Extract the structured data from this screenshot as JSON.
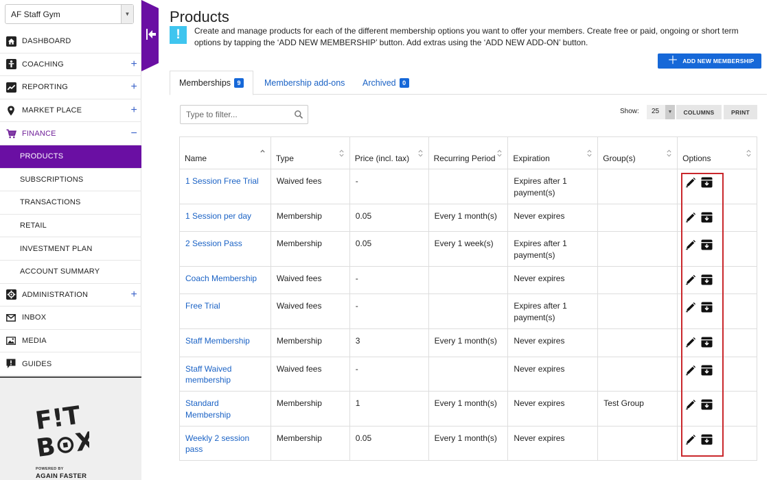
{
  "sidebar": {
    "gym_name": "AF Staff Gym",
    "items": [
      {
        "label": "DASHBOARD",
        "icon": "home-icon"
      },
      {
        "label": "COACHING",
        "icon": "coaching-icon",
        "expand": "+"
      },
      {
        "label": "REPORTING",
        "icon": "chart-icon",
        "expand": "+"
      },
      {
        "label": "MARKET PLACE",
        "icon": "location-pin-icon",
        "expand": "+"
      },
      {
        "label": "FINANCE",
        "icon": "cart-icon",
        "expand": "−"
      },
      {
        "label": "PRODUCTS"
      },
      {
        "label": "SUBSCRIPTIONS"
      },
      {
        "label": "TRANSACTIONS"
      },
      {
        "label": "RETAIL"
      },
      {
        "label": "INVESTMENT PLAN"
      },
      {
        "label": "ACCOUNT SUMMARY"
      },
      {
        "label": "ADMINISTRATION",
        "icon": "gear-icon",
        "expand": "+"
      },
      {
        "label": "INBOX",
        "icon": "mail-icon"
      },
      {
        "label": "MEDIA",
        "icon": "image-icon"
      },
      {
        "label": "GUIDES",
        "icon": "help-icon"
      }
    ],
    "footer": {
      "logo_text": "F!T BOX",
      "powered": "POWERED BY",
      "brand": "AGAIN FASTER"
    }
  },
  "main": {
    "title": "Products",
    "description": "Create and manage products for each of the different membership options you want to offer your members. Create free or paid, ongoing or short term options by tapping the ‘ADD NEW MEMBERSHIP’ button. Add extras using the ‘ADD NEW ADD-ON’ button.",
    "add_button": "ADD NEW MEMBERSHIP",
    "tabs": [
      {
        "label": "Memberships",
        "count": "9"
      },
      {
        "label": "Membership add-ons"
      },
      {
        "label": "Archived",
        "count": "0"
      }
    ],
    "filter_placeholder": "Type to filter...",
    "show_label": "Show:",
    "show_value": "25",
    "columns_button": "COLUMNS",
    "print_button": "PRINT"
  },
  "table": {
    "headers": [
      "Name",
      "Type",
      "Price (incl. tax)",
      "Recurring Period",
      "Expiration",
      "Group(s)",
      "Options"
    ],
    "rows": [
      {
        "name": "1 Session Free Trial",
        "type": "Waived fees",
        "price": "-",
        "period": "",
        "expiration": "Expires after 1 payment(s)",
        "groups": ""
      },
      {
        "name": "1 Session per day",
        "type": "Membership",
        "price": "0.05",
        "period": "Every 1 month(s)",
        "expiration": "Never expires",
        "groups": ""
      },
      {
        "name": "2 Session Pass",
        "type": "Membership",
        "price": "0.05",
        "period": "Every 1 week(s)",
        "expiration": "Expires after 1 payment(s)",
        "groups": ""
      },
      {
        "name": "Coach Membership",
        "type": "Waived fees",
        "price": "-",
        "period": "",
        "expiration": "Never expires",
        "groups": ""
      },
      {
        "name": "Free Trial",
        "type": "Waived fees",
        "price": "-",
        "period": "",
        "expiration": "Expires after 1 payment(s)",
        "groups": ""
      },
      {
        "name": "Staff Membership",
        "type": "Membership",
        "price": "3",
        "period": "Every 1 month(s)",
        "expiration": "Never expires",
        "groups": ""
      },
      {
        "name": "Staff Waived membership",
        "type": "Waived fees",
        "price": "-",
        "period": "",
        "expiration": "Never expires",
        "groups": ""
      },
      {
        "name": "Standard Membership",
        "type": "Membership",
        "price": "1",
        "period": "Every 1 month(s)",
        "expiration": "Never expires",
        "groups": "Test Group"
      },
      {
        "name": "Weekly 2 session pass",
        "type": "Membership",
        "price": "0.05",
        "period": "Every 1 month(s)",
        "expiration": "Never expires",
        "groups": ""
      }
    ]
  },
  "colors": {
    "brand_purple": "#6a0fa3",
    "accent_blue": "#1668d8",
    "link_blue": "#1a62c5",
    "info_cyan": "#3fc5ef",
    "highlight_red": "#c9262b"
  }
}
